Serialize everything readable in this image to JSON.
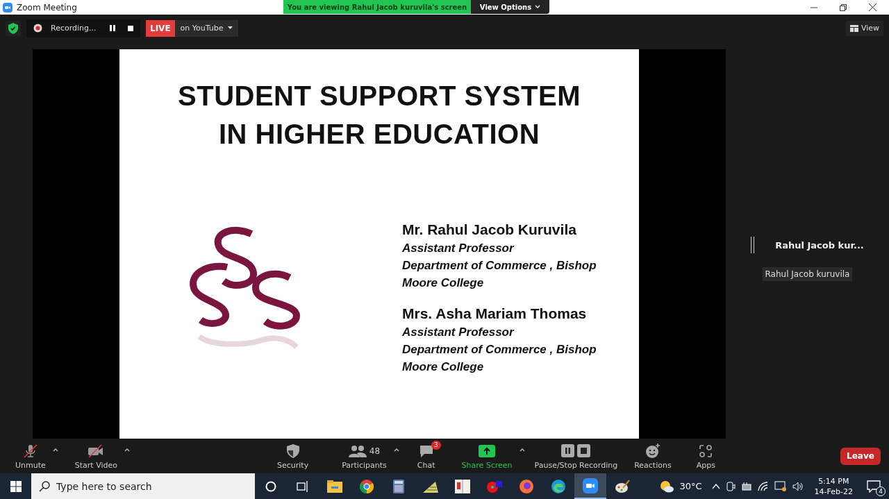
{
  "window": {
    "title": "Zoom Meeting"
  },
  "top_bar": {
    "recording": {
      "label": "Recording..."
    },
    "live": {
      "badge": "LIVE",
      "target": "on YouTube"
    },
    "view_button": "View"
  },
  "share_banner": {
    "text": "You are viewing Rahul Jacob kuruvila's screen",
    "options": "View Options"
  },
  "slide": {
    "title_lines": [
      "STUDENT SUPPORT SYSTEM",
      "IN HIGHER EDUCATION"
    ],
    "presenters": [
      {
        "name": "Mr. Rahul Jacob Kuruvila",
        "role": "Assistant Professor",
        "department": "Department of Commerce , Bishop Moore College"
      },
      {
        "name": "Mrs. Asha Mariam Thomas",
        "role": "Assistant Professor",
        "department": "Department of Commerce , Bishop Moore College"
      }
    ]
  },
  "participant": {
    "name": "Rahul Jacob kur...",
    "tooltip": "Rahul Jacob kuruvila"
  },
  "toolbar": {
    "items": [
      {
        "kind": "mic",
        "label": "Unmute",
        "off": true
      },
      {
        "kind": "video",
        "label": "Start Video",
        "off": true
      },
      {
        "kind": "security",
        "label": "Security"
      },
      {
        "kind": "participants",
        "label": "Participants",
        "count": "48"
      },
      {
        "kind": "chat",
        "label": "Chat",
        "badge": "3"
      },
      {
        "kind": "share",
        "label": "Share Screen"
      },
      {
        "kind": "recording",
        "label": "Pause/Stop Recording"
      },
      {
        "kind": "reactions",
        "label": "Reactions"
      },
      {
        "kind": "apps",
        "label": "Apps"
      }
    ],
    "leave": "Leave"
  },
  "taskbar": {
    "search": {
      "placeholder": "Type here to search"
    },
    "apps": [
      {
        "kind": "cortana",
        "selected": false
      },
      {
        "kind": "taskview",
        "selected": false
      },
      {
        "kind": "explorer",
        "selected": false
      },
      {
        "kind": "chrome",
        "selected": false
      },
      {
        "kind": "calculator",
        "selected": false
      },
      {
        "kind": "tally",
        "selected": false
      },
      {
        "kind": "book",
        "selected": false
      },
      {
        "kind": "redapp",
        "selected": false
      },
      {
        "kind": "firefox",
        "selected": false
      },
      {
        "kind": "edge",
        "selected": false
      },
      {
        "kind": "zoom",
        "selected": true
      },
      {
        "kind": "paint",
        "selected": false
      }
    ],
    "weather": "30°C",
    "time": "5:14 PM",
    "date": "14-Feb-22",
    "notifications": "4"
  }
}
